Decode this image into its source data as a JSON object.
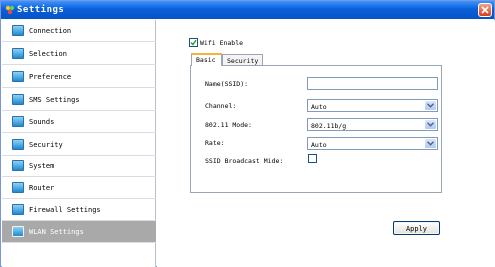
{
  "window": {
    "title": "Settings",
    "accent": "#0a5fd8"
  },
  "sidebar": {
    "items": [
      {
        "label": "Connection",
        "icon": "connection-icon"
      },
      {
        "label": "Selection",
        "icon": "selection-icon"
      },
      {
        "label": "Preference",
        "icon": "preference-icon"
      },
      {
        "label": "SMS Settings",
        "icon": "sms-icon"
      },
      {
        "label": "Sounds",
        "icon": "sound-icon"
      },
      {
        "label": "Security",
        "icon": "security-icon"
      },
      {
        "label": "System",
        "icon": "system-icon"
      },
      {
        "label": "Router",
        "icon": "router-icon"
      },
      {
        "label": "Firewall Settings",
        "icon": "firewall-icon"
      },
      {
        "label": "WLAN Settings",
        "icon": "wlan-icon",
        "active": true
      }
    ]
  },
  "wlan": {
    "wifi_enable_label": "Wifi Enable",
    "wifi_enabled": true,
    "tabs": [
      {
        "label": "Basic",
        "active": true
      },
      {
        "label": "Security"
      }
    ],
    "fields": {
      "ssid_label": "Name(SSID):",
      "ssid_value": "",
      "channel_label": "Channel:",
      "channel_value": "Auto",
      "mode_label": "802.11 Mode:",
      "mode_value": "802.11b/g",
      "rate_label": "Rate:",
      "rate_value": "Auto",
      "ssid_broadcast_label": "SSID Broadcast Mide:",
      "ssid_broadcast_checked": false
    },
    "apply_label": "Apply"
  }
}
